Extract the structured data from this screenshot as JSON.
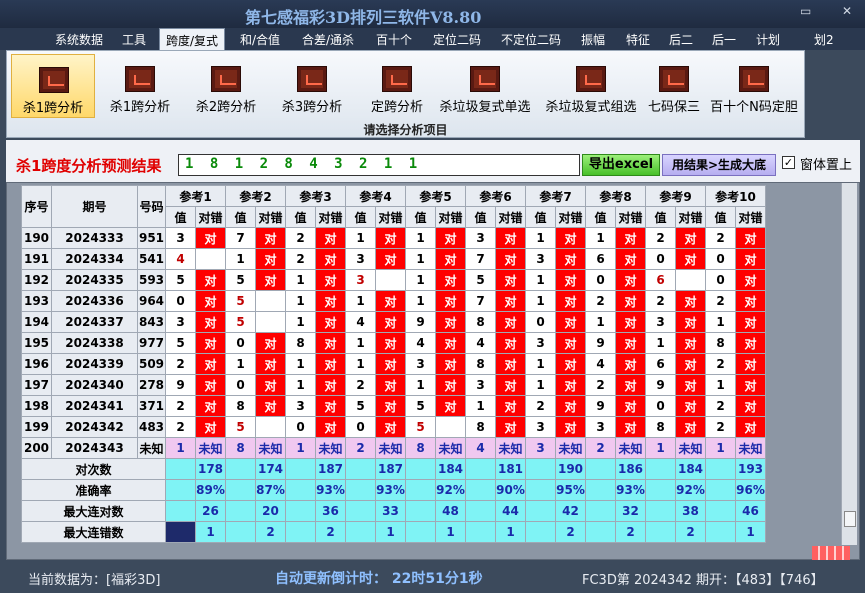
{
  "window": {
    "title": "第七感福彩3D排列三软件V8.80",
    "restore_glyph": "▭",
    "close_glyph": "✕"
  },
  "menu": [
    "系统数据",
    "工具",
    "跨度/复式",
    "和/合值",
    "合差/通杀",
    "百十个",
    "定位二码",
    "不定位二码",
    "振幅",
    "特征",
    "后二",
    "后一",
    "计划",
    "划2"
  ],
  "ribbon": {
    "buttons": [
      "杀1跨分析",
      "杀1跨分析",
      "杀2跨分析",
      "杀3跨分析",
      "定跨分析",
      "杀垃圾复式单选",
      "杀垃圾复式组选",
      "七码保三",
      "百十个N码定胆"
    ],
    "group_label": "请选择分析项目",
    "icon": "chart-icon"
  },
  "result": {
    "title": "杀1跨度分析预测结果",
    "value": "1 8 1 2 8 4 3 2 1 1",
    "excel_label": "导出excel",
    "gen_label": "用结果>生成大底",
    "pin_checked": "✓",
    "pin_label": "窗体置上"
  },
  "grid": {
    "head_idx": "序号",
    "head_period": "期号",
    "head_num": "号码",
    "refs": [
      "参考1",
      "参考2",
      "参考3",
      "参考4",
      "参考5",
      "参考6",
      "参考7",
      "参考8",
      "参考9",
      "参考10"
    ],
    "sub_val": "值",
    "sub_dc": "对错",
    "rows": [
      {
        "idx": "190",
        "period": "2024333",
        "num": "951",
        "vals": [
          "3",
          "7",
          "2",
          "1",
          "1",
          "3",
          "1",
          "1",
          "2",
          "2"
        ],
        "dc": [
          "对",
          "对",
          "对",
          "对",
          "对",
          "对",
          "对",
          "对",
          "对",
          "对"
        ],
        "red": []
      },
      {
        "idx": "191",
        "period": "2024334",
        "num": "541",
        "vals": [
          "4",
          "1",
          "2",
          "3",
          "1",
          "7",
          "3",
          "6",
          "0",
          "0"
        ],
        "dc": [
          "",
          "对",
          "对",
          "对",
          "对",
          "对",
          "对",
          "对",
          "对",
          "对"
        ],
        "red": [
          0
        ]
      },
      {
        "idx": "192",
        "period": "2024335",
        "num": "593",
        "vals": [
          "5",
          "5",
          "1",
          "3",
          "1",
          "5",
          "1",
          "0",
          "6",
          "0"
        ],
        "dc": [
          "对",
          "对",
          "对",
          "",
          "对",
          "对",
          "对",
          "对",
          "",
          "对"
        ],
        "red": [
          3,
          8
        ]
      },
      {
        "idx": "193",
        "period": "2024336",
        "num": "964",
        "vals": [
          "0",
          "5",
          "1",
          "1",
          "1",
          "7",
          "1",
          "2",
          "2",
          "2"
        ],
        "dc": [
          "对",
          "",
          "对",
          "对",
          "对",
          "对",
          "对",
          "对",
          "对",
          "对"
        ],
        "red": [
          1
        ]
      },
      {
        "idx": "194",
        "period": "2024337",
        "num": "843",
        "vals": [
          "3",
          "5",
          "1",
          "4",
          "9",
          "8",
          "0",
          "1",
          "3",
          "1"
        ],
        "dc": [
          "对",
          "",
          "对",
          "对",
          "对",
          "对",
          "对",
          "对",
          "对",
          "对"
        ],
        "red": [
          1
        ]
      },
      {
        "idx": "195",
        "period": "2024338",
        "num": "977",
        "vals": [
          "5",
          "0",
          "8",
          "1",
          "4",
          "4",
          "3",
          "9",
          "1",
          "8"
        ],
        "dc": [
          "对",
          "对",
          "对",
          "对",
          "对",
          "对",
          "对",
          "对",
          "对",
          "对"
        ],
        "red": []
      },
      {
        "idx": "196",
        "period": "2024339",
        "num": "509",
        "vals": [
          "2",
          "1",
          "1",
          "1",
          "3",
          "8",
          "1",
          "4",
          "6",
          "2"
        ],
        "dc": [
          "对",
          "对",
          "对",
          "对",
          "对",
          "对",
          "对",
          "对",
          "对",
          "对"
        ],
        "red": []
      },
      {
        "idx": "197",
        "period": "2024340",
        "num": "278",
        "vals": [
          "9",
          "0",
          "1",
          "2",
          "1",
          "3",
          "1",
          "2",
          "9",
          "1"
        ],
        "dc": [
          "对",
          "对",
          "对",
          "对",
          "对",
          "对",
          "对",
          "对",
          "对",
          "对"
        ],
        "red": []
      },
      {
        "idx": "198",
        "period": "2024341",
        "num": "371",
        "vals": [
          "2",
          "8",
          "3",
          "5",
          "5",
          "1",
          "2",
          "9",
          "0",
          "2"
        ],
        "dc": [
          "对",
          "对",
          "对",
          "对",
          "对",
          "对",
          "对",
          "对",
          "对",
          "对"
        ],
        "red": []
      },
      {
        "idx": "199",
        "period": "2024342",
        "num": "483",
        "vals": [
          "2",
          "5",
          "0",
          "0",
          "5",
          "8",
          "3",
          "3",
          "8",
          "2"
        ],
        "dc": [
          "对",
          "",
          "对",
          "对",
          "",
          "对",
          "对",
          "对",
          "对",
          "对"
        ],
        "red": [
          1,
          4
        ]
      },
      {
        "idx": "200",
        "period": "2024343",
        "num": "未知",
        "vals": [
          "1",
          "8",
          "1",
          "2",
          "8",
          "4",
          "3",
          "2",
          "1",
          "1"
        ],
        "dc": [
          "未知",
          "未知",
          "未知",
          "未知",
          "未知",
          "未知",
          "未知",
          "未知",
          "未知",
          "未知"
        ],
        "red": [],
        "last": true
      }
    ],
    "stats": [
      {
        "label": "对次数",
        "values": [
          "178",
          "174",
          "187",
          "187",
          "184",
          "181",
          "190",
          "186",
          "184",
          "193"
        ]
      },
      {
        "label": "准确率",
        "values": [
          "89%",
          "87%",
          "93%",
          "93%",
          "92%",
          "90%",
          "95%",
          "93%",
          "92%",
          "96%"
        ]
      },
      {
        "label": "最大连对数",
        "values": [
          "26",
          "20",
          "36",
          "33",
          "48",
          "44",
          "42",
          "32",
          "38",
          "46"
        ]
      },
      {
        "label": "最大连错数",
        "values": [
          "1",
          "2",
          "2",
          "1",
          "1",
          "1",
          "2",
          "2",
          "2",
          "1"
        ]
      }
    ]
  },
  "status": {
    "left": "当前数据为：[福彩3D]",
    "mid": "自动更新倒计时：  22时51分1秒",
    "right": "FC3D第 2024342 期开：【483】【746】"
  }
}
